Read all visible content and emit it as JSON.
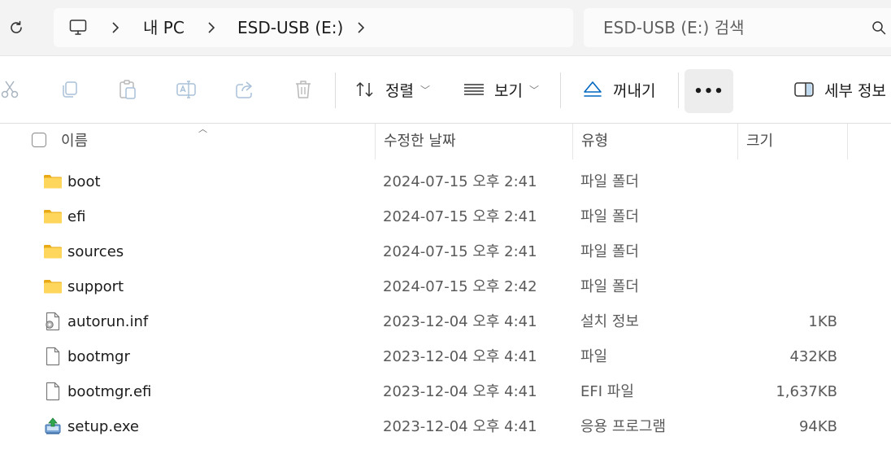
{
  "address": {
    "crumbs": [
      "내 PC",
      "ESD-USB (E:)"
    ],
    "search_placeholder": "ESD-USB (E:) 검색"
  },
  "toolbar": {
    "icons": [
      "cut-icon",
      "copy-icon",
      "paste-icon",
      "rename-icon",
      "share-icon",
      "delete-icon"
    ],
    "sort_label": "정렬",
    "view_label": "보기",
    "eject_label": "꺼내기",
    "more_label": "•••",
    "details_label": "세부 정보",
    "accent": "#0067c0"
  },
  "columns": {
    "name": "이름",
    "date": "수정한 날짜",
    "type": "유형",
    "size": "크기"
  },
  "files": [
    {
      "name": "boot",
      "date": "2024-07-15 오후 2:41",
      "type": "파일 폴더",
      "size": "",
      "icon": "folder-icon"
    },
    {
      "name": "efi",
      "date": "2024-07-15 오후 2:41",
      "type": "파일 폴더",
      "size": "",
      "icon": "folder-icon"
    },
    {
      "name": "sources",
      "date": "2024-07-15 오후 2:41",
      "type": "파일 폴더",
      "size": "",
      "icon": "folder-icon"
    },
    {
      "name": "support",
      "date": "2024-07-15 오후 2:42",
      "type": "파일 폴더",
      "size": "",
      "icon": "folder-icon"
    },
    {
      "name": "autorun.inf",
      "date": "2023-12-04 오후 4:41",
      "type": "설치 정보",
      "size": "1KB",
      "icon": "setup-info-icon"
    },
    {
      "name": "bootmgr",
      "date": "2023-12-04 오후 4:41",
      "type": "파일",
      "size": "432KB",
      "icon": "file-icon"
    },
    {
      "name": "bootmgr.efi",
      "date": "2023-12-04 오후 4:41",
      "type": "EFI 파일",
      "size": "1,637KB",
      "icon": "file-icon"
    },
    {
      "name": "setup.exe",
      "date": "2023-12-04 오후 4:41",
      "type": "응용 프로그램",
      "size": "94KB",
      "icon": "setup-exe-icon"
    }
  ]
}
